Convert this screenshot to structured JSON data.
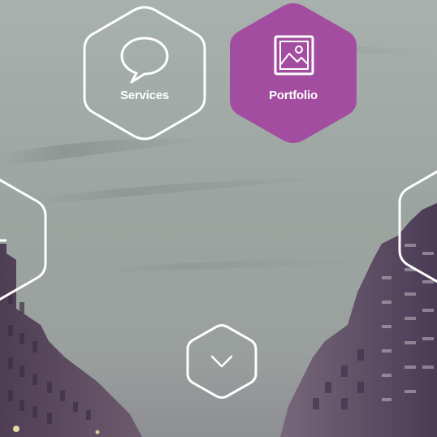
{
  "hero": {
    "colors": {
      "sky_top": "#a3aba8",
      "sky_mid": "#9aa39f",
      "building_shadow": "#5a4a5c",
      "hex_outline": "#ffffff",
      "accent": "#a24d9f"
    },
    "tiles": [
      {
        "label": "Services",
        "icon": "speech-bubble-icon",
        "active": false
      },
      {
        "label": "Portfolio",
        "icon": "image-icon",
        "active": true
      }
    ],
    "side_tiles": [
      {
        "position": "left",
        "icon": "partial-hex"
      },
      {
        "position": "right",
        "icon": "partial-hex"
      }
    ],
    "scroll_button": {
      "icon": "chevron-down-icon"
    }
  }
}
